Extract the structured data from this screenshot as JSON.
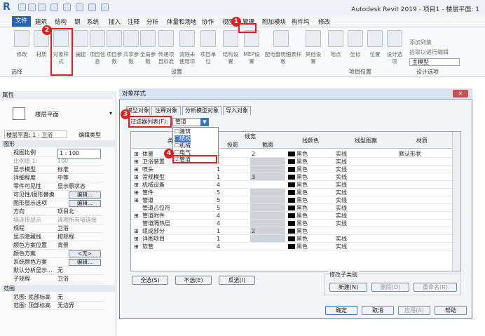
{
  "window": {
    "title": "Autodesk Revit 2019 - 项目1 - 楼层平面: 1"
  },
  "menu": {
    "file": "文件",
    "items": [
      "建筑",
      "结构",
      "钢",
      "系统",
      "插入",
      "注释",
      "分析",
      "体量和场地",
      "协作",
      "视图",
      "管理",
      "附加模块",
      "构件坞",
      "修改"
    ]
  },
  "ribbon": {
    "buttons": [
      "修改",
      "材质",
      "对象样式",
      "捕捉",
      "项目信息",
      "项目参数",
      "共享参数",
      "全局参数",
      "传递项目标准",
      "清除未使用项",
      "项目单位",
      "结构设置",
      "MEP设置",
      "配电盘明细表样板",
      "其他设置",
      "地点",
      "坐标",
      "位置",
      "设计选项",
      "主模型"
    ],
    "groups": [
      "选择",
      "设置",
      "项目位置",
      "设计选项"
    ],
    "right_items": [
      "添加到集",
      "拾取以进行编辑"
    ]
  },
  "properties": {
    "title": "属性",
    "type_name": "楼层平面",
    "view_selector": "楼层平面: 1 - 卫浴",
    "edit_type": "编辑类型",
    "section_graphics": "图形",
    "section_range": "范围",
    "rows": [
      {
        "k": "视图比例",
        "v": "1 : 100"
      },
      {
        "k": "比例值 1:",
        "v": "100"
      },
      {
        "k": "显示模型",
        "v": "标准"
      },
      {
        "k": "详细程度",
        "v": "中等"
      },
      {
        "k": "零件可见性",
        "v": "显示原状态"
      },
      {
        "k": "可见性/图形替换",
        "v": "编辑..."
      },
      {
        "k": "图形显示选项",
        "v": "编辑..."
      },
      {
        "k": "方向",
        "v": "项目北"
      },
      {
        "k": "墙连接显示",
        "v": "清理所有墙连接"
      },
      {
        "k": "规程",
        "v": "卫浴"
      },
      {
        "k": "显示隐藏线",
        "v": "按规程"
      },
      {
        "k": "颜色方案位置",
        "v": "背景"
      },
      {
        "k": "颜色方案",
        "v": "<无>"
      },
      {
        "k": "系统颜色方案",
        "v": "编辑..."
      },
      {
        "k": "默认分析显示...",
        "v": "无"
      },
      {
        "k": "子规程",
        "v": "卫浴"
      }
    ],
    "range_rows": [
      {
        "k": "范围: 底部标高",
        "v": "无"
      },
      {
        "k": "范围: 顶部标高",
        "v": "无边界"
      }
    ]
  },
  "dialog": {
    "title": "对象样式",
    "tabs": [
      "模型对象",
      "注释对象",
      "分析模型对象",
      "导入对象"
    ],
    "filter_label": "过滤器列表(F):",
    "filter_value": "管道",
    "filter_options": [
      "建筑",
      "结构",
      "机械",
      "电气",
      "管道"
    ],
    "headers": {
      "category": "类别",
      "lineweight": "线宽",
      "projection": "投影",
      "cut": "截面",
      "linecolor": "线颜色",
      "linepattern": "线型图案",
      "material": "材质"
    },
    "rows": [
      {
        "name": "体量",
        "proj": "1",
        "cut": "2",
        "color": "黑色",
        "pattern": "实线",
        "material": "默认形状",
        "expand": true
      },
      {
        "name": "卫浴装置",
        "proj": "1",
        "cut": "",
        "color": "黑色",
        "pattern": "实线",
        "material": "",
        "expand": true
      },
      {
        "name": "喷头",
        "proj": "1",
        "cut": "",
        "color": "黑色",
        "pattern": "实线",
        "material": "",
        "expand": true
      },
      {
        "name": "常规模型",
        "proj": "1",
        "cut": "3",
        "color": "黑色",
        "pattern": "实线",
        "material": "",
        "expand": true
      },
      {
        "name": "机械设备",
        "proj": "4",
        "cut": "",
        "color": "黑色",
        "pattern": "实线",
        "material": "",
        "expand": true
      },
      {
        "name": "管件",
        "proj": "5",
        "cut": "",
        "color": "黑色",
        "pattern": "实线",
        "material": "",
        "expand": true
      },
      {
        "name": "管道",
        "proj": "5",
        "cut": "",
        "color": "黑色",
        "pattern": "实线",
        "material": "",
        "expand": true
      },
      {
        "name": "管道占位符",
        "proj": "5",
        "cut": "",
        "color": "黑色",
        "pattern": "实线",
        "material": "",
        "expand": false
      },
      {
        "name": "管道附件",
        "proj": "4",
        "cut": "",
        "color": "黑色",
        "pattern": "实线",
        "material": "",
        "expand": true
      },
      {
        "name": "管道隔热层",
        "proj": "4",
        "cut": "",
        "color": "黑色",
        "pattern": "实线",
        "material": "",
        "expand": false
      },
      {
        "name": "组成部分",
        "proj": "1",
        "cut": "2",
        "color": "黑色",
        "pattern": "",
        "material": "",
        "expand": true
      },
      {
        "name": "详图项目",
        "proj": "1",
        "cut": "",
        "color": "黑色",
        "pattern": "实线",
        "material": "",
        "expand": true
      },
      {
        "name": "软管",
        "proj": "4",
        "cut": "",
        "color": "黑色",
        "pattern": "实线",
        "material": "",
        "expand": true
      }
    ],
    "buttons": {
      "select_all": "全选(S)",
      "select_none": "不选(E)",
      "invert": "反选(I)",
      "modify_sub": "修改子类别",
      "new": "新建(N)",
      "delete": "删除(D)",
      "rename": "重命名(R)",
      "ok": "确定",
      "cancel": "取消",
      "apply": "应用(A)",
      "help": "帮助"
    }
  },
  "callouts": [
    "1",
    "2",
    "3",
    "4"
  ],
  "colors": {
    "accent": "#2a64b8",
    "callout": "#e02020"
  }
}
